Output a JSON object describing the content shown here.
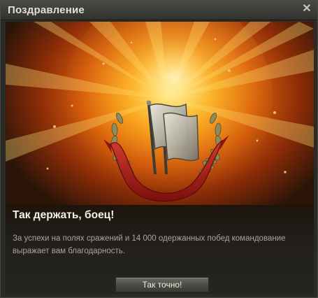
{
  "window": {
    "title": "Поздравление"
  },
  "icons": {
    "close": "close-icon",
    "badge": "victory-flags-badge-icon"
  },
  "content": {
    "heading": "Так держать, боец!",
    "message": "За успехи на полях сражений и 14 000 одержанных побед командование выражает вам благодарность.",
    "confirm_label": "Так точно!"
  },
  "colors": {
    "background_glow": "#f79a14",
    "ribbon": "#b01f1c",
    "laurel": "#8a8a55",
    "flags": "#c9c6b8"
  }
}
